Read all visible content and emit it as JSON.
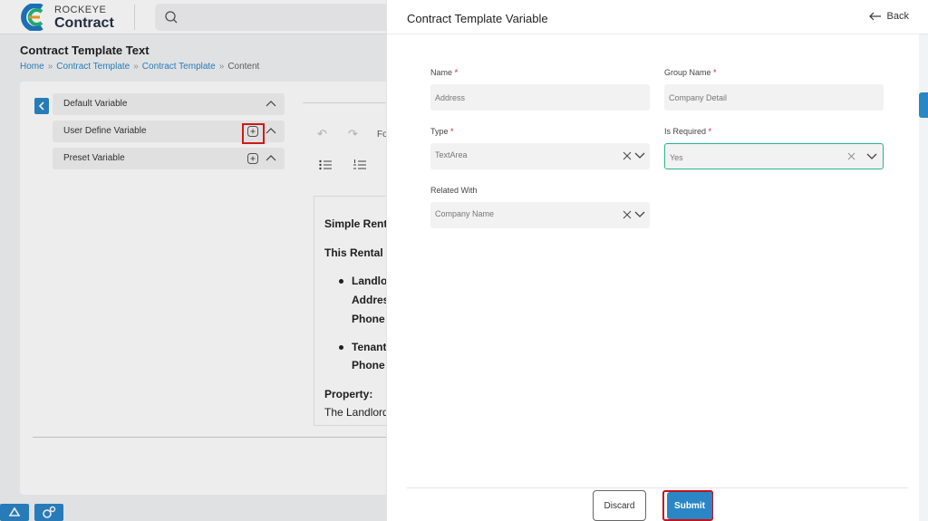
{
  "app": {
    "brand_top": "ROCKEYE",
    "brand_main": "Contract",
    "search_icon": "search-icon"
  },
  "page": {
    "title": "Contract Template Text",
    "breadcrumb": [
      "Home",
      "Contract Template",
      "Contract Template",
      "Content"
    ],
    "breadcrumb_separator": "»"
  },
  "variables": {
    "items": [
      {
        "label": "Default Variable",
        "icon": "chevron-up-icon"
      },
      {
        "label": "User Define Variable",
        "icon": "plus-square-icon"
      },
      {
        "label": "Preset Variable",
        "icon": "plus-square-icon"
      }
    ]
  },
  "editor": {
    "toolbar_partial": "Fo",
    "doc_lines": [
      "Simple Rent",
      "This Rental",
      "Landlo",
      "Addres",
      "Phone",
      "Tenant",
      "Phone",
      "Property:",
      "The Landlord"
    ]
  },
  "drawer": {
    "title": "Contract Template Variable",
    "back_label": "Back",
    "fields": {
      "name": {
        "label": "Name",
        "required": "*",
        "value": "Address"
      },
      "group_name": {
        "label": "Group Name",
        "required": "*",
        "value": "Company Detail"
      },
      "type": {
        "label": "Type",
        "required": "*",
        "value": "TextArea"
      },
      "is_required": {
        "label": "Is Required",
        "required": "*",
        "value": "Yes"
      },
      "related_with": {
        "label": "Related With",
        "value": "Company Name"
      }
    },
    "discard_label": "Discard",
    "submit_label": "Submit"
  },
  "colors": {
    "accent": "#2b86c5",
    "highlight": "#e01b1b",
    "focus_border": "#28b48c"
  }
}
